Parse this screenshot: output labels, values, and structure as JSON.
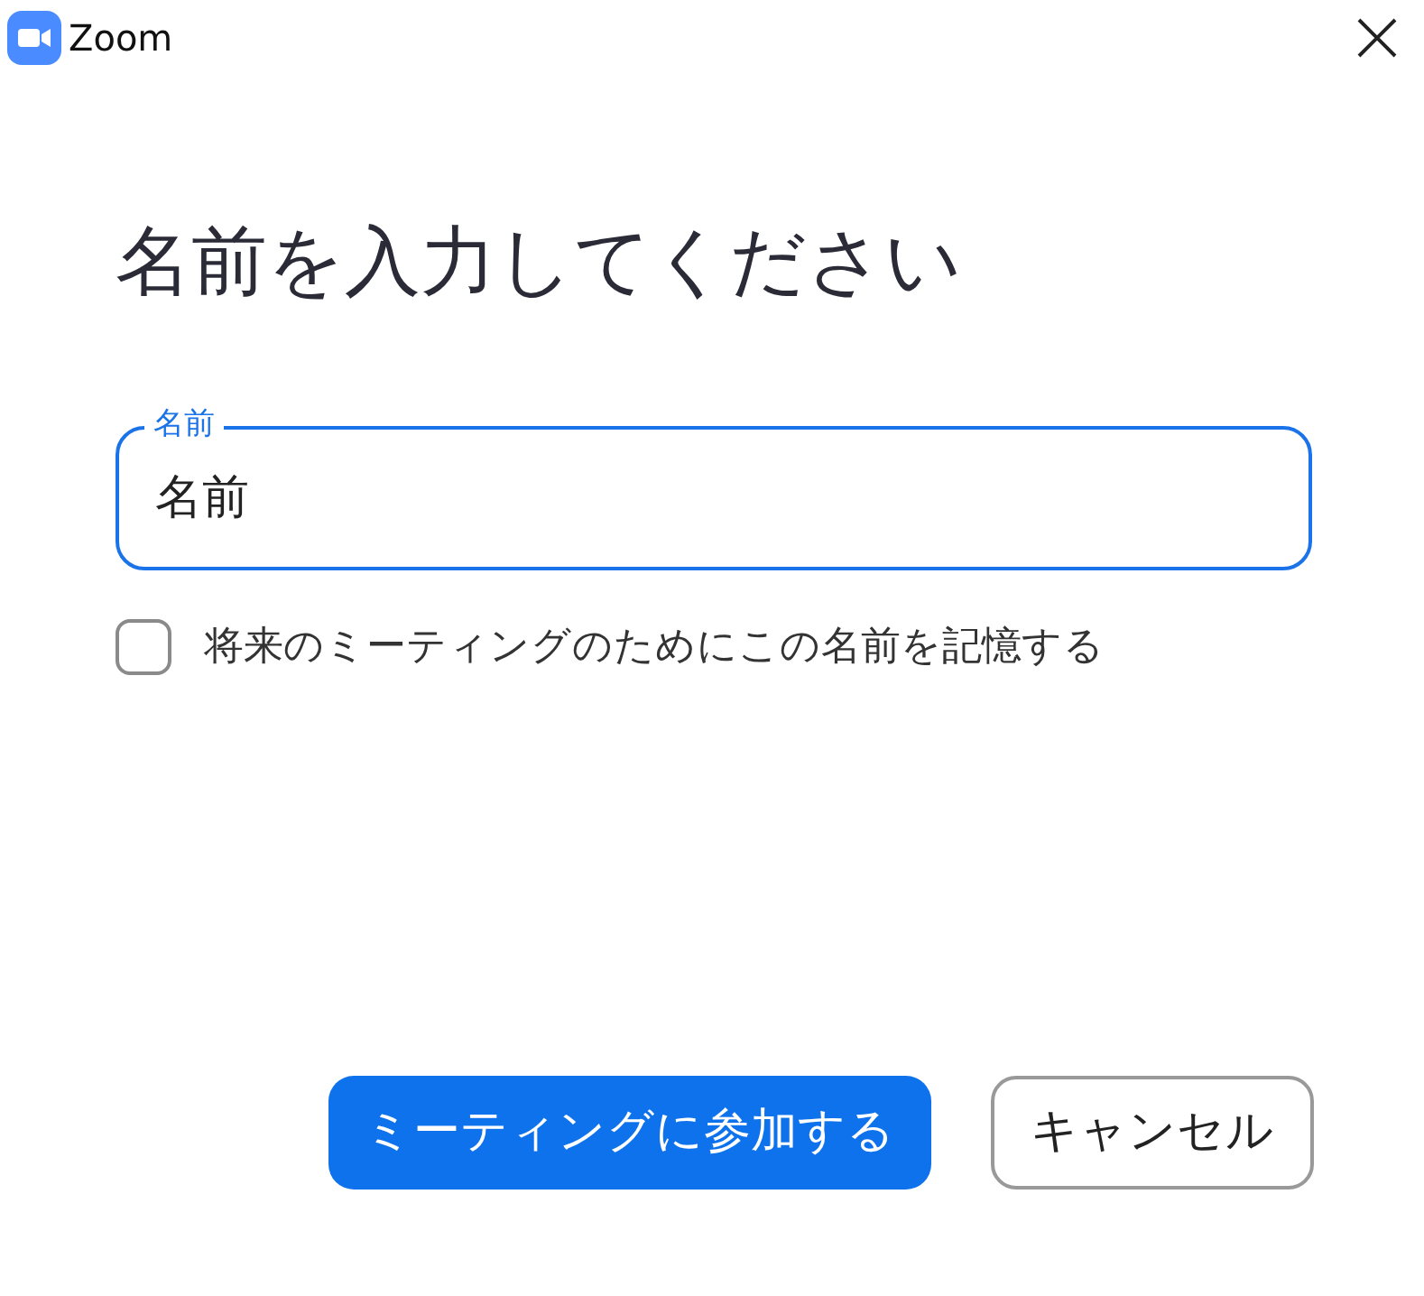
{
  "window": {
    "title": "Zoom"
  },
  "heading": "名前を入力してください",
  "name_field": {
    "label": "名前",
    "value": "名前",
    "focused": true
  },
  "remember": {
    "label": "将来のミーティングのためにこの名前を記憶する",
    "checked": false
  },
  "buttons": [
    {
      "label": "ミーティングに参加する",
      "kind": "primary"
    },
    {
      "label": "キャンセル",
      "kind": "secondary"
    }
  ]
}
